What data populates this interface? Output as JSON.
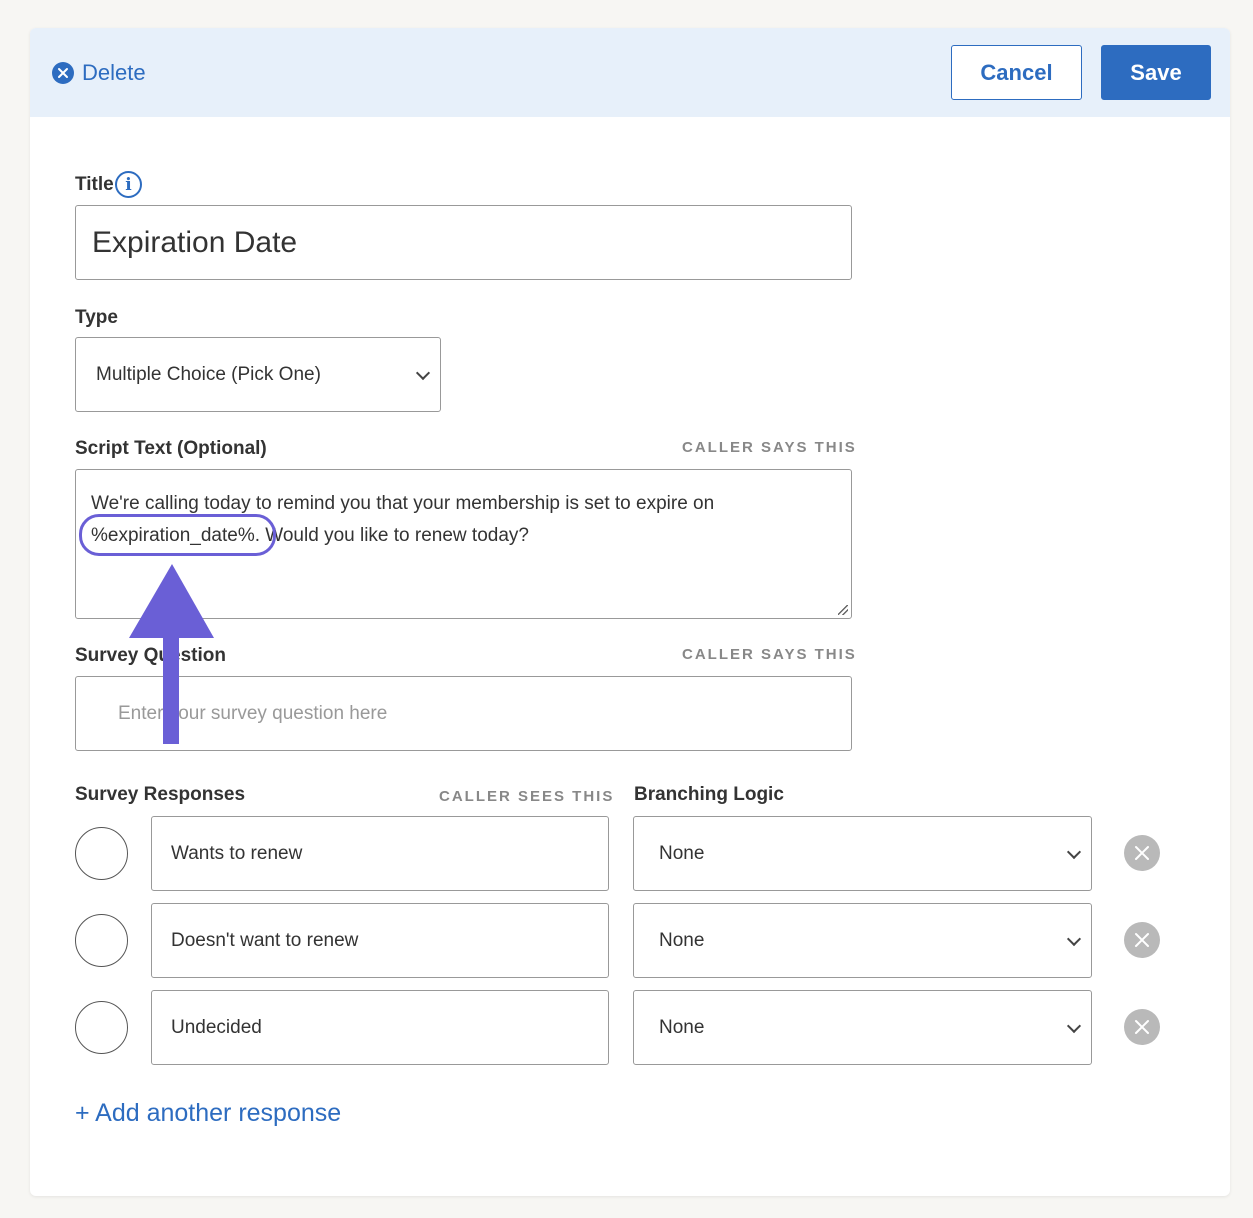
{
  "header": {
    "delete_label": "Delete",
    "cancel_label": "Cancel",
    "save_label": "Save"
  },
  "title_field": {
    "label": "Title",
    "value": "Expiration Date"
  },
  "type_field": {
    "label": "Type",
    "selected": "Multiple Choice (Pick One)"
  },
  "script_field": {
    "label": "Script Text (Optional)",
    "hint": "CALLER SAYS THIS",
    "line1": "We're calling today to remind you that your membership is set to expire on",
    "token": "%expiration_date%.",
    "line2_rest": " Would you like to renew today?"
  },
  "question_field": {
    "label": "Survey Question",
    "hint": "CALLER SAYS THIS",
    "placeholder": "Enter your survey question here"
  },
  "responses": {
    "label": "Survey Responses",
    "hint": "CALLER SEES THIS",
    "branching_label": "Branching Logic",
    "items": [
      {
        "text": "Wants to renew",
        "branch": "None"
      },
      {
        "text": "Doesn't want to renew",
        "branch": "None"
      },
      {
        "text": "Undecided",
        "branch": "None"
      }
    ],
    "add_label": "+ Add another response"
  },
  "colors": {
    "accent": "#2d6cc0",
    "header_bg": "#e7f0fa",
    "annotation": "#6a5fd6"
  },
  "icons": [
    "close-circle-icon",
    "info-icon",
    "chevron-down-icon",
    "remove-x-icon",
    "annotation-arrow-icon"
  ]
}
